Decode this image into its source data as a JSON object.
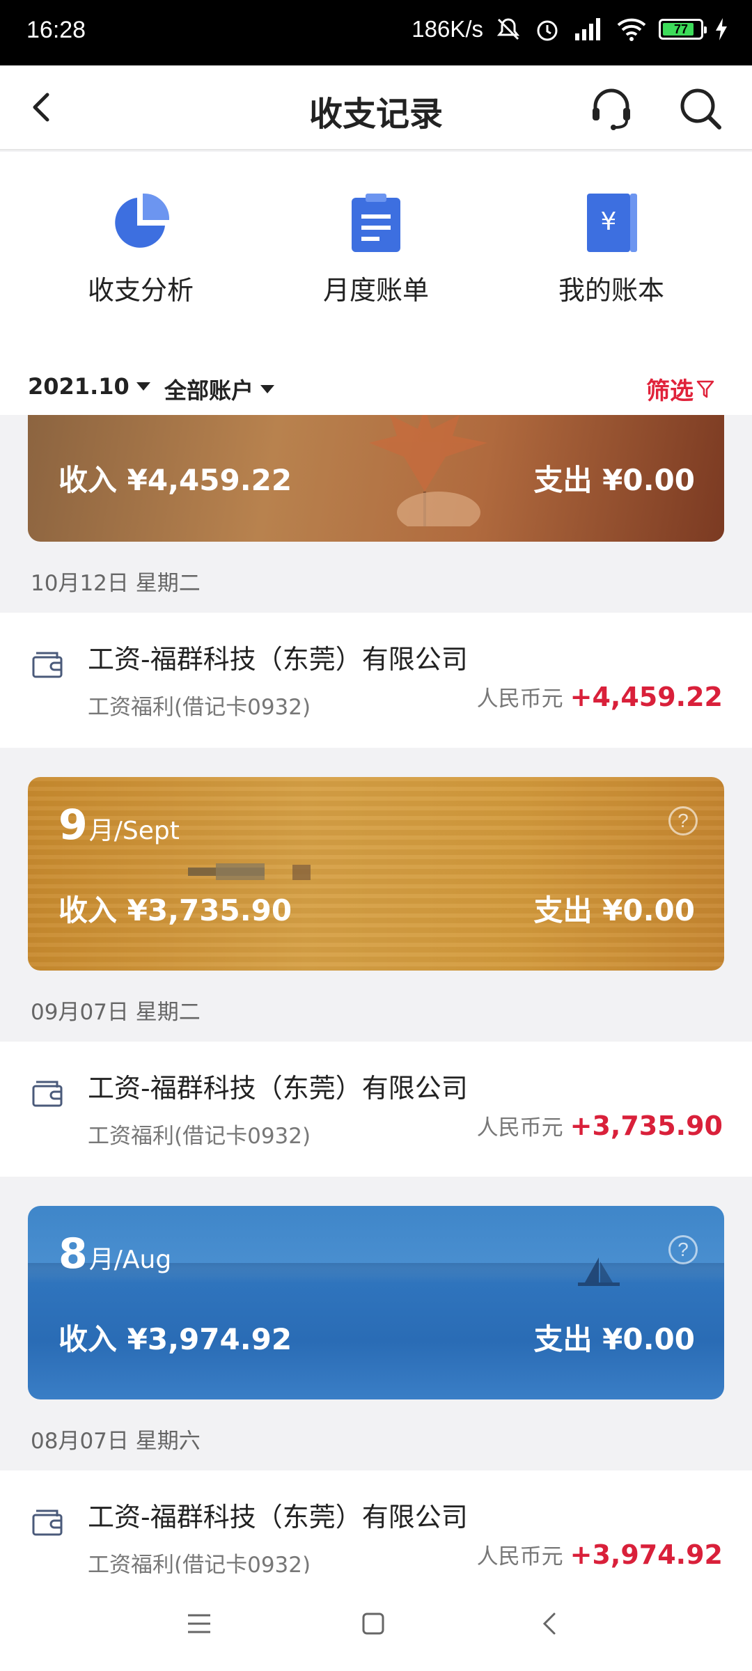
{
  "status_bar": {
    "time": "16:28",
    "speed": "186K/s",
    "battery": "77"
  },
  "header": {
    "title": "收支记录"
  },
  "shortcuts": [
    {
      "label": "收支分析",
      "icon": "pie-chart-icon"
    },
    {
      "label": "月度账单",
      "icon": "clipboard-icon"
    },
    {
      "label": "我的账本",
      "icon": "ledger-icon"
    }
  ],
  "filters": {
    "month": "2021.10",
    "account": "全部账户",
    "filter_label": "筛选"
  },
  "months": [
    {
      "month_num": "",
      "month_suffix": "",
      "income": "收入 ¥4,459.22",
      "expense": "支出 ¥0.00",
      "date": "10月12日 星期二",
      "tx": {
        "title": "工资-福群科技（东莞）有限公司",
        "sub": "工资福利(借记卡0932)",
        "currency": "人民币元",
        "amount": "+4,459.22"
      }
    },
    {
      "month_num": "9",
      "month_suffix": "月/Sept",
      "income": "收入 ¥3,735.90",
      "expense": "支出 ¥0.00",
      "date": "09月07日 星期二",
      "tx": {
        "title": "工资-福群科技（东莞）有限公司",
        "sub": "工资福利(借记卡0932)",
        "currency": "人民币元",
        "amount": "+3,735.90"
      }
    },
    {
      "month_num": "8",
      "month_suffix": "月/Aug",
      "income": "收入 ¥3,974.92",
      "expense": "支出 ¥0.00",
      "date": "08月07日 星期六",
      "tx": {
        "title": "工资-福群科技（东莞）有限公司",
        "sub": "工资福利(借记卡0932)",
        "currency": "人民币元",
        "amount": "+3,974.92"
      }
    }
  ],
  "help_symbol": "?",
  "colors": {
    "accent_red": "#d9203a",
    "filter_red": "#e0223a",
    "icon_blue": "#3d6fe0"
  }
}
